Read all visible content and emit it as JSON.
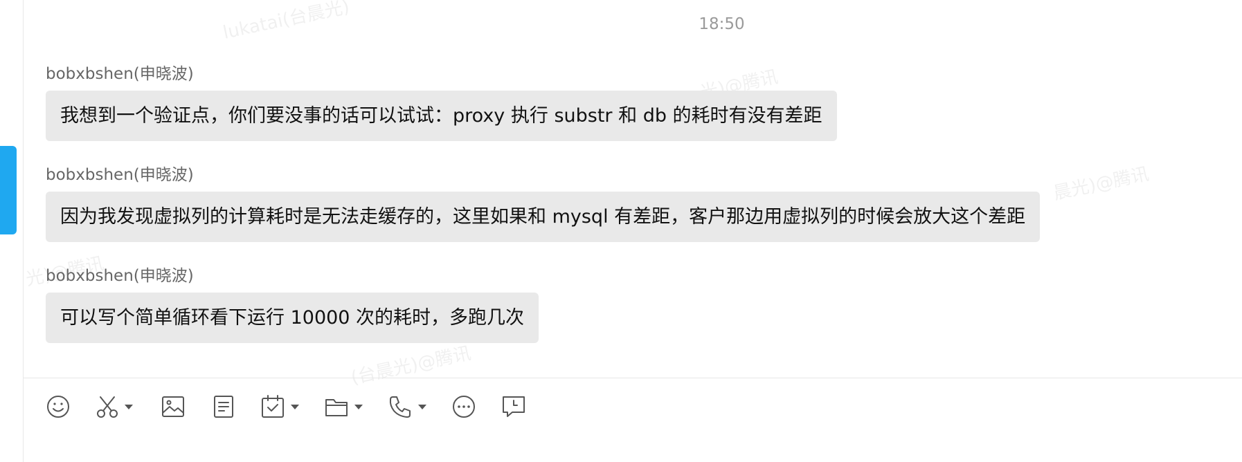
{
  "chat": {
    "timestamp": "18:50",
    "messages": [
      {
        "sender": "bobxbshen(申晓波)",
        "text": "我想到一个验证点，你们要没事的话可以试试：proxy 执行 substr 和 db 的耗时有没有差距"
      },
      {
        "sender": "bobxbshen(申晓波)",
        "text": "因为我发现虚拟列的计算耗时是无法走缓存的，这里如果和 mysql 有差距，客户那边用虚拟列的时候会放大这个差距"
      },
      {
        "sender": "bobxbshen(申晓波)",
        "text": "可以写个简单循环看下运行 10000 次的耗时，多跑几次"
      }
    ]
  },
  "watermarks": [
    "lukatai(台晨光)",
    "光)@腾讯",
    "晨光)@腾讯",
    "光)@腾讯",
    "(台晨光)@腾讯"
  ],
  "toolbar": {
    "tools": [
      {
        "icon": "emoji-icon",
        "has_dropdown": false
      },
      {
        "icon": "scissors-icon",
        "has_dropdown": true
      },
      {
        "icon": "image-icon",
        "has_dropdown": false
      },
      {
        "icon": "document-icon",
        "has_dropdown": false
      },
      {
        "icon": "calendar-check-icon",
        "has_dropdown": true
      },
      {
        "icon": "folder-icon",
        "has_dropdown": true
      },
      {
        "icon": "phone-icon",
        "has_dropdown": true
      },
      {
        "icon": "more-icon",
        "has_dropdown": false
      },
      {
        "icon": "chat-history-icon",
        "has_dropdown": false
      }
    ]
  },
  "colors": {
    "accent": "#1fa8f0",
    "bubble": "#e9e9e9",
    "sender_text": "#666666",
    "timestamp_text": "#9a9a9a"
  }
}
